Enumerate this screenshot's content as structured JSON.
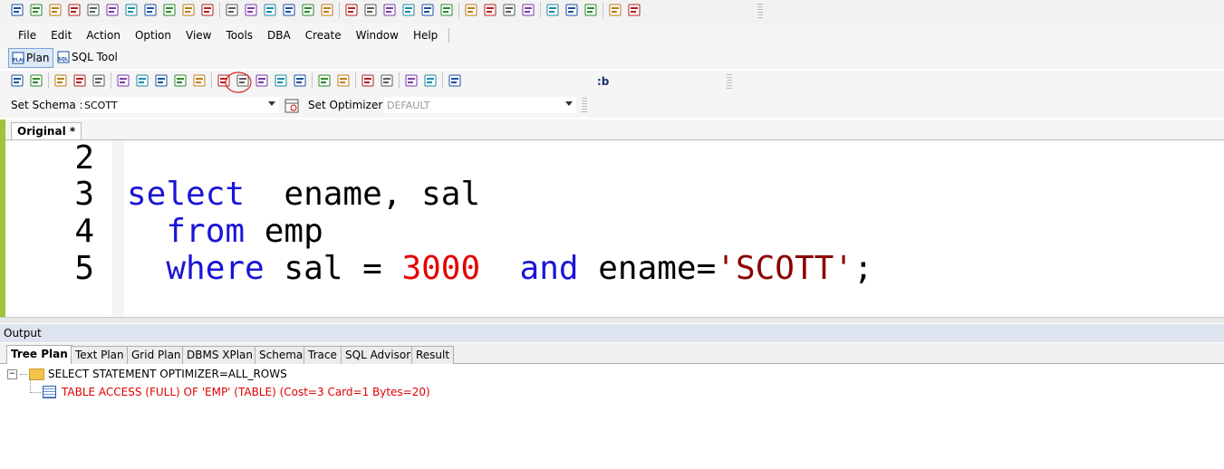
{
  "menu": [
    "File",
    "Edit",
    "Action",
    "Option",
    "View",
    "Tools",
    "DBA",
    "Create",
    "Window",
    "Help"
  ],
  "toolbar_top_icons": [
    "sql-icon",
    "plan-sql-icon",
    "plan-icon",
    "edit-icon",
    "tune-icon",
    "database-icon",
    "search-db-icon",
    "table-icon",
    "compare-icon",
    "edit-doc-icon",
    "copy-icon",
    "sql-small-icon",
    "settings-icon",
    "transfer-icon",
    "lock-icon",
    "db-icon",
    "clock-icon",
    "ash-icon",
    "flow-icon",
    "grid-icon",
    "analysis-icon",
    "chart-icon",
    "stats-icon",
    "tool-icon",
    "db2-icon",
    "user-icon",
    "check-icon",
    "log-icon",
    "report-icon",
    "list-icon",
    "monitor-icon",
    "window-icon"
  ],
  "mode": {
    "plan_label": "Plan",
    "sqltool_label": "SQL Tool"
  },
  "toolbar2_icons": [
    "settings-icon",
    "new-icon",
    "open-icon",
    "save-icon",
    "print-icon",
    "plan-icon",
    "plan2-icon",
    "tune-icon",
    "sql-plan-icon",
    "trace-icon",
    "stop-icon",
    "cut-icon",
    "copy-icon",
    "paste-icon",
    "all-icon",
    "undo-icon",
    "redo-icon",
    "comment-icon",
    "uncomment-icon",
    "find-icon",
    "find-next-icon",
    "replace-icon",
    "bookmark-icon",
    "hint-icon",
    "bind-icon",
    "grid-icon",
    "format-icon",
    "error-icon",
    "options-icon"
  ],
  "toolbar2_bind_label": ":b",
  "schema": {
    "label": "Set Schema :",
    "value": "SCOTT",
    "optimizer_label": "Set Optimizer :",
    "optimizer_value": "DEFAULT"
  },
  "editor": {
    "tab_label": "Original *",
    "line_numbers": [
      "2",
      "3",
      "4",
      "5"
    ],
    "lines": [
      {
        "parts": []
      },
      {
        "parts": [
          {
            "t": "select",
            "c": "kw"
          },
          {
            "t": "  ename, sal",
            "c": ""
          }
        ]
      },
      {
        "parts": [
          {
            "t": "  ",
            "c": ""
          },
          {
            "t": "from",
            "c": "kw"
          },
          {
            "t": " emp",
            "c": ""
          }
        ]
      },
      {
        "parts": [
          {
            "t": "  ",
            "c": ""
          },
          {
            "t": "where",
            "c": "kw"
          },
          {
            "t": " sal = ",
            "c": ""
          },
          {
            "t": "3000",
            "c": "num"
          },
          {
            "t": "  ",
            "c": ""
          },
          {
            "t": "and",
            "c": "kw"
          },
          {
            "t": " ename=",
            "c": ""
          },
          {
            "t": "'SCOTT'",
            "c": "str"
          },
          {
            "t": ";",
            "c": ""
          }
        ]
      }
    ]
  },
  "output": {
    "header": "Output",
    "tabs": [
      "Tree Plan",
      "Text Plan",
      "Grid Plan",
      "DBMS XPlan",
      "Schema",
      "Trace",
      "SQL Advisor",
      "Result"
    ],
    "tree": [
      {
        "text": "SELECT STATEMENT OPTIMIZER=ALL_ROWS",
        "color": "black"
      },
      {
        "text": "TABLE ACCESS (FULL) OF 'EMP' (TABLE) (Cost=3 Card=1 Bytes=20)",
        "color": "red"
      }
    ]
  },
  "colors": {
    "keyword": "#1a14d6",
    "number": "#e30000",
    "string": "#8a0000",
    "editor_strip": "#9fc43a",
    "plan_row": "#e00000"
  }
}
